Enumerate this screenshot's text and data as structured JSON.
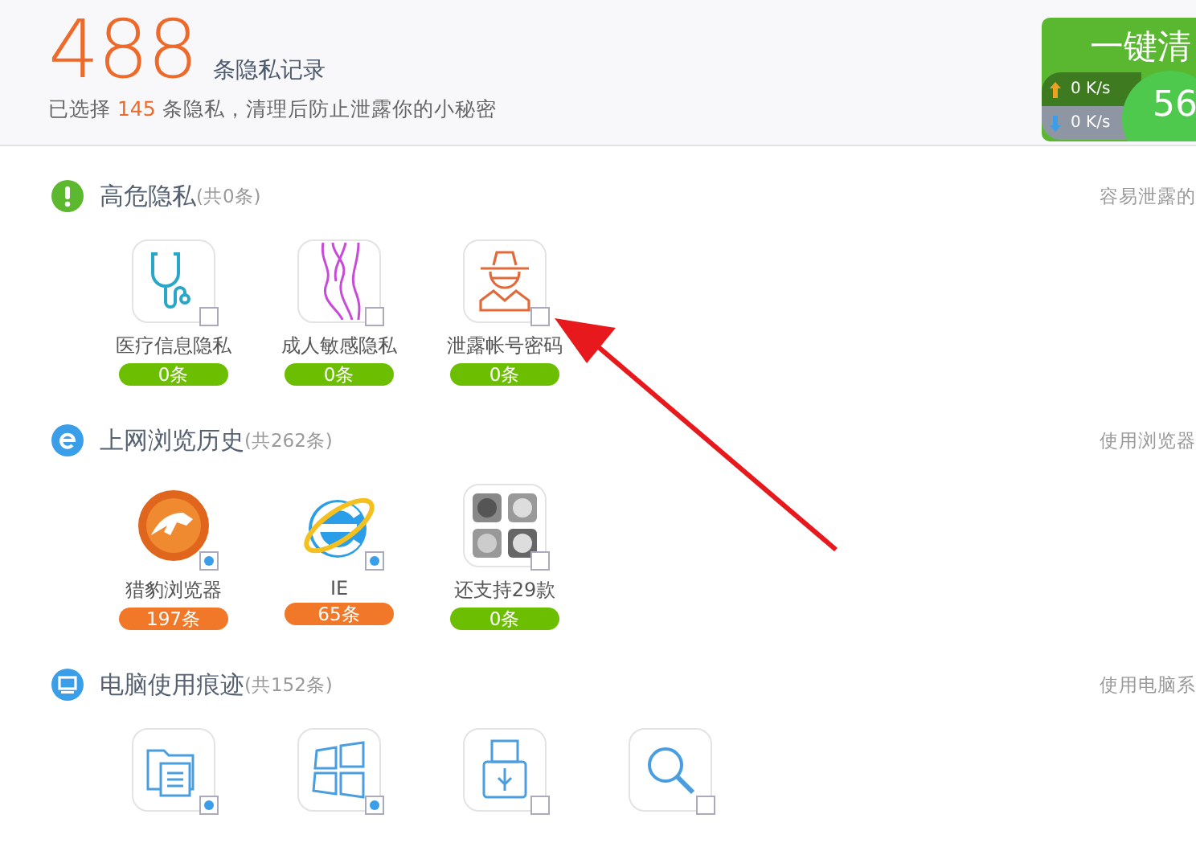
{
  "summary": {
    "total": "488",
    "total_label": "条隐私记录",
    "selected_prefix": "已选择",
    "selected_count": "145",
    "selected_suffix": "条隐私，清理后防止泄露你的小秘密"
  },
  "clean_button": {
    "label": "一键清",
    "score": "56"
  },
  "speed": {
    "upload": "0 K/s",
    "download": "0 K/s"
  },
  "sections": [
    {
      "kind": "warning",
      "title": "高危隐私",
      "count": "(共0条)",
      "hint": "容易泄露的",
      "items": [
        {
          "kind": "stethoscope",
          "label": "医疗信息隐私",
          "count": "0条",
          "color": "#6cbf00",
          "checked": false
        },
        {
          "kind": "legs",
          "label": "成人敏感隐私",
          "count": "0条",
          "color": "#6cbf00",
          "checked": false
        },
        {
          "kind": "spy",
          "label": "泄露帐号密码",
          "count": "0条",
          "color": "#6cbf00",
          "checked": false
        }
      ]
    },
    {
      "kind": "browser",
      "title": "上网浏览历史",
      "count": "(共262条)",
      "hint": "使用浏览器",
      "items": [
        {
          "kind": "cheetah",
          "label": "猎豹浏览器",
          "count": "197条",
          "color": "#f07828",
          "checked": true
        },
        {
          "kind": "ie",
          "label": "IE",
          "count": "65条",
          "color": "#f07828",
          "checked": true
        },
        {
          "kind": "more-browsers",
          "label": "还支持29款",
          "count": "0条",
          "color": "#6cbf00",
          "checked": false
        }
      ]
    },
    {
      "kind": "computer",
      "title": "电脑使用痕迹",
      "count": "(共152条)",
      "hint": "使用电脑系",
      "items": [
        {
          "kind": "folder",
          "checked": true
        },
        {
          "kind": "windows",
          "checked": true
        },
        {
          "kind": "usb",
          "checked": false
        },
        {
          "kind": "magnifier",
          "checked": false
        }
      ]
    }
  ]
}
